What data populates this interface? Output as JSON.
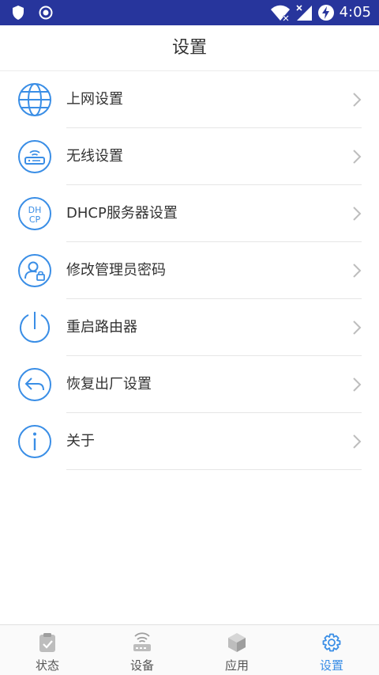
{
  "status_bar": {
    "time": "4:05"
  },
  "header": {
    "title": "设置"
  },
  "menu": {
    "items": [
      {
        "label": "上网设置",
        "icon": "globe-icon"
      },
      {
        "label": "无线设置",
        "icon": "router-icon"
      },
      {
        "label": "DHCP服务器设置",
        "icon": "dhcp-icon",
        "icon_text_top": "DH",
        "icon_text_bottom": "CP"
      },
      {
        "label": "修改管理员密码",
        "icon": "user-lock-icon"
      },
      {
        "label": "重启路由器",
        "icon": "power-icon"
      },
      {
        "label": "恢复出厂设置",
        "icon": "reply-arrow-icon"
      },
      {
        "label": "关于",
        "icon": "info-icon"
      }
    ]
  },
  "tabs": [
    {
      "label": "状态",
      "icon": "status-clipboard-icon",
      "active": false
    },
    {
      "label": "设备",
      "icon": "device-router-icon",
      "active": false
    },
    {
      "label": "应用",
      "icon": "app-cube-icon",
      "active": false
    },
    {
      "label": "设置",
      "icon": "settings-gear-icon",
      "active": true
    }
  ],
  "colors": {
    "status_bar": "#27359c",
    "icon_blue": "#3a8ee6",
    "text": "#333333",
    "chevron": "#bdbdbd",
    "divider": "#e6e6e6"
  }
}
